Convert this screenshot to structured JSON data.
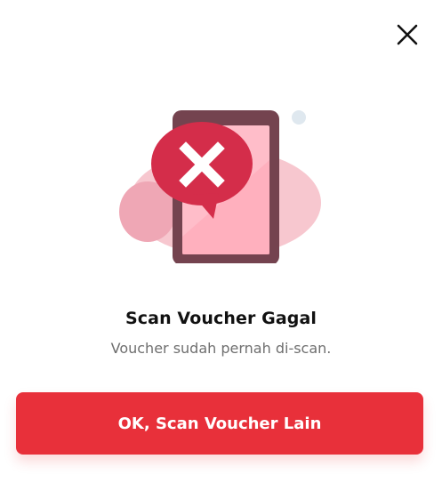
{
  "dialog": {
    "close_icon": "close-icon",
    "illustration_icon": "scan-failed-phone-illustration",
    "title": "Scan Voucher Gagal",
    "message": "Voucher sudah pernah di-scan.",
    "primary_button_label": "OK, Scan Voucher Lain"
  },
  "colors": {
    "accent": "#e8303a",
    "error_badge": "#d42d4a",
    "title_text": "#111111",
    "message_text": "#6f6f6f"
  }
}
